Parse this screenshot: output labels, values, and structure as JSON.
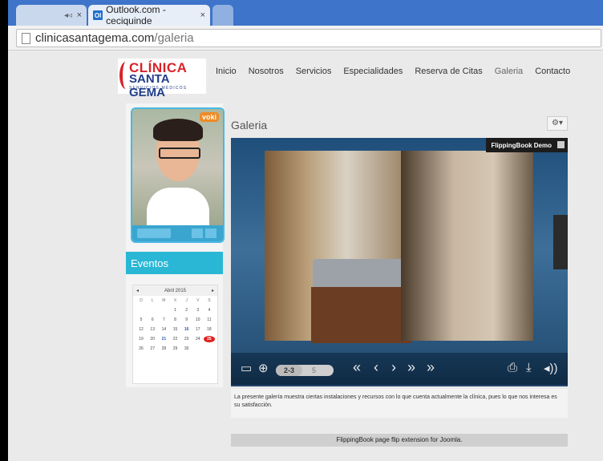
{
  "browser": {
    "tabs": [
      {
        "label": "",
        "close": "×"
      },
      {
        "label": "Outlook.com - ceciquinde",
        "close": "×",
        "icon": "outlook-icon"
      },
      {
        "label": ""
      }
    ],
    "url_host": "clinicasantagema.com",
    "url_path": "/galeria"
  },
  "site": {
    "logo_line1": "CLÍNICA",
    "logo_line2": "SANTA GEMA",
    "logo_line3": "SERVICIOS MÉDICOS",
    "nav": [
      "Inicio",
      "Nosotros",
      "Servicios",
      "Especialidades",
      "Reserva de Citas",
      "Galeria",
      "Contacto"
    ]
  },
  "sidebar": {
    "voki_badge": "voki",
    "eventos_title": "Eventos",
    "calendar": {
      "month": "Abril 2015",
      "prev": "◂",
      "next": "▸",
      "weekdays": [
        "D",
        "L",
        "M",
        "X",
        "J",
        "V",
        "S"
      ],
      "days": [
        "",
        "",
        "",
        "1",
        "2",
        "3",
        "4",
        "5",
        "6",
        "7",
        "8",
        "9",
        "10",
        "11",
        "12",
        "13",
        "14",
        "15",
        "16",
        "17",
        "18",
        "19",
        "20",
        "21",
        "22",
        "23",
        "24",
        "25",
        "26",
        "27",
        "28",
        "29",
        "30",
        "",
        ""
      ],
      "highlight_blue": [
        "16",
        "21"
      ],
      "today": "25"
    }
  },
  "main": {
    "title": "Galeria",
    "gear": "⚙▾",
    "viewer": {
      "demo_label": "FlippingBook Demo",
      "pager_current": "2-3",
      "pager_next": "5"
    },
    "description": "La presente galería muestra ciertas instalaciones y recursos con lo que cuenta actualmente la clínica, pues lo que nos interesa es su satisfacción.",
    "footer": "FlippingBook page flip extension for Joomla."
  },
  "colors": {
    "accent": "#2ab7d6",
    "chrome_tabbar": "#3e74c9",
    "today_red": "#e02020"
  }
}
